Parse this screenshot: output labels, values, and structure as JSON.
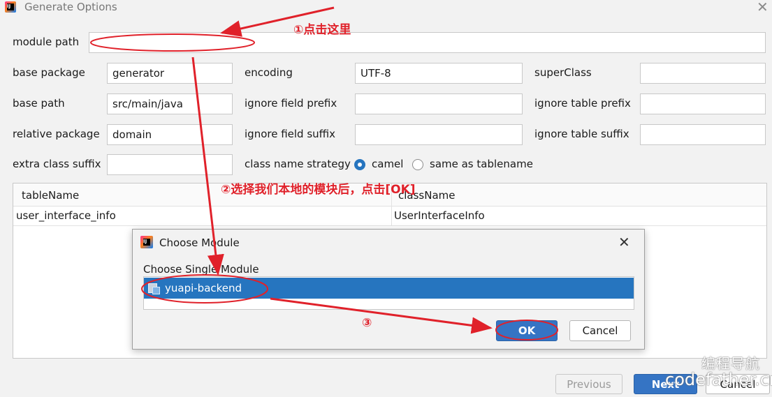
{
  "window": {
    "title": "Generate Options",
    "logo_text": "IJ",
    "close_glyph": "✕"
  },
  "form": {
    "module_path": {
      "label": "module path",
      "value": ""
    },
    "base_package": {
      "label": "base package",
      "value": "generator"
    },
    "encoding": {
      "label": "encoding",
      "value": "UTF-8"
    },
    "super_class": {
      "label": "superClass",
      "value": ""
    },
    "base_path": {
      "label": "base path",
      "value": "src/main/java"
    },
    "ignore_field_prefix": {
      "label": "ignore field prefix",
      "value": ""
    },
    "ignore_table_prefix": {
      "label": "ignore table prefix",
      "value": ""
    },
    "relative_package": {
      "label": "relative package",
      "value": "domain"
    },
    "ignore_field_suffix": {
      "label": "ignore field suffix",
      "value": ""
    },
    "ignore_table_suffix": {
      "label": "ignore table suffix",
      "value": ""
    },
    "extra_class_suffix": {
      "label": "extra class suffix",
      "value": ""
    },
    "class_name_strategy": {
      "label": "class name strategy",
      "options": [
        "camel",
        "same as tablename"
      ],
      "selected": "camel"
    }
  },
  "table": {
    "headers": [
      "tableName",
      "className"
    ],
    "rows": [
      [
        "user_interface_info",
        "UserInterfaceInfo"
      ]
    ]
  },
  "dialog": {
    "title": "Choose Module",
    "logo_text": "IJ",
    "close_glyph": "✕",
    "list_label": "Choose Single Module",
    "items": [
      "yuapi-backend"
    ],
    "ok_label": "OK",
    "cancel_label": "Cancel"
  },
  "footer": {
    "previous_label": "Previous",
    "next_label": "Next",
    "cancel_label": "Cancel"
  },
  "annotations": {
    "step1": "①点击这里",
    "step2": "②选择我们本地的模块后，点击[OK]",
    "step3": "③"
  },
  "watermark": {
    "line1": "编程导航",
    "line2": "codefather.cn"
  },
  "colors": {
    "accent": "#2675bf",
    "annotation_red": "#e0212a"
  }
}
